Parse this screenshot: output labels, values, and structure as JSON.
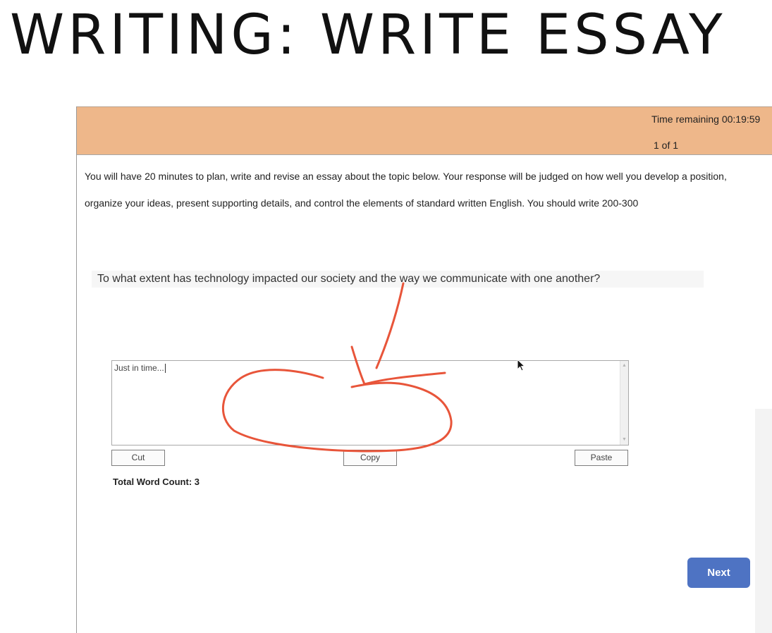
{
  "slide": {
    "title": "WRITING: WRITE ESSAY"
  },
  "header": {
    "time_remaining": "Time remaining 00:19:59",
    "page_count": "1 of 1"
  },
  "instructions": "You will have 20 minutes to plan, write and revise an essay about the topic below. Your response will be judged on how well you develop a position, organize your ideas, present supporting details, and control the elements of standard written English. You should write 200-300",
  "prompt": "To what extent has technology impacted our society and the way we communicate with one another?",
  "essay": {
    "value": "Just in time..."
  },
  "buttons": {
    "cut": "Cut",
    "copy": "Copy",
    "paste": "Paste",
    "next": "Next"
  },
  "word_count": "Total Word Count: 3",
  "colors": {
    "header_bg": "#eeb78a",
    "next_button": "#4e73c3",
    "annotation": "#e8553a"
  },
  "icons": {
    "scroll_up": "scroll-up-arrow-icon",
    "scroll_down": "scroll-down-arrow-icon",
    "cursor": "mouse-pointer-icon"
  }
}
